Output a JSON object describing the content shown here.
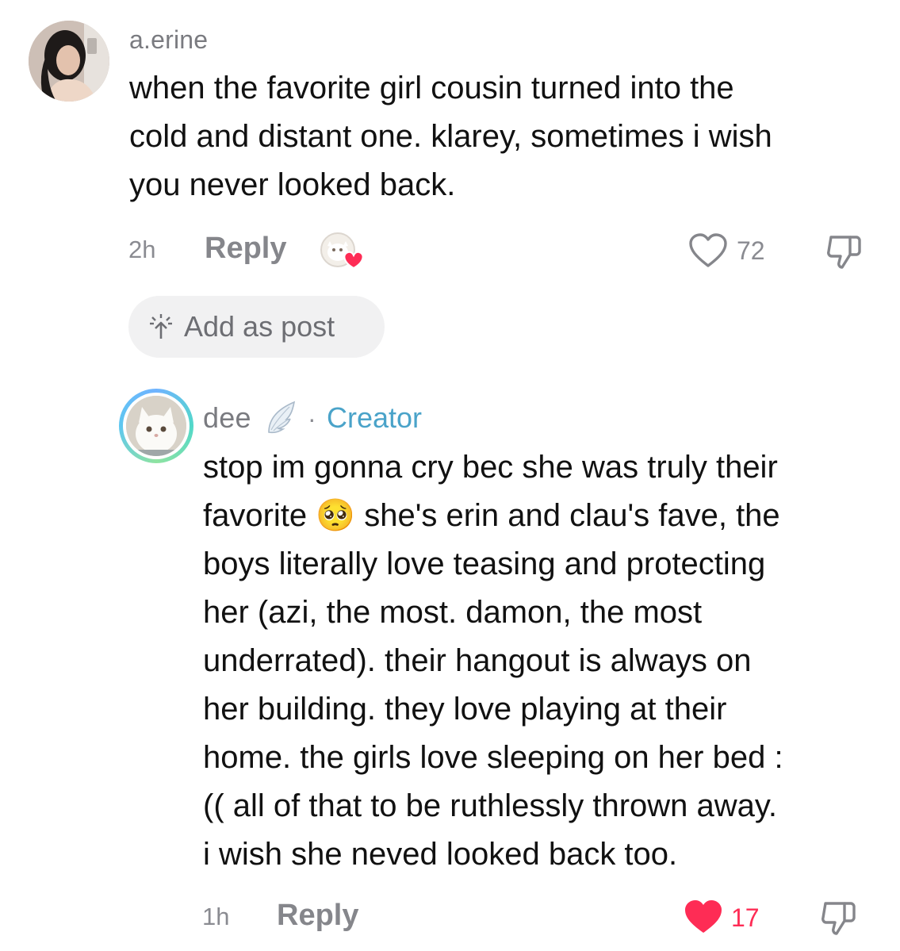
{
  "top_comment": {
    "username": "a.erine",
    "text_lines": [
      "when the favorite girl cousin turned into the",
      "cold and distant one. klarey, sometimes i wish",
      "you never looked back."
    ],
    "time": "2h",
    "reply_label": "Reply",
    "like_count": "72",
    "liked_by_creator": true,
    "add_as_post_label": "Add as post"
  },
  "reply_comment": {
    "username": "dee",
    "username_emoji": "🪽",
    "separator": "·",
    "badge": "Creator",
    "text_lines": [
      "stop im gonna cry bec she was truly their",
      "favorite 🥺 she's erin and clau's fave, the",
      "boys literally love teasing and protecting",
      "her (azi, the most. damon, the most",
      "underrated). their hangout is always on",
      "her building. they love playing at their",
      "home. the girls love sleeping on her bed :",
      "(( all of that to be ruthlessly thrown away.",
      "i wish she neved looked back too."
    ],
    "time": "1h",
    "reply_label": "Reply",
    "like_count": "17",
    "liked": true
  },
  "colors": {
    "like_red": "#fe2c55",
    "creator_blue": "#4aa3c9",
    "muted_gray": "#8a8b91"
  },
  "icons": {
    "like": "heart-outline-icon",
    "liked": "heart-filled-icon",
    "dislike": "thumbs-down-icon",
    "add_post": "sparkle-arrow-icon"
  }
}
